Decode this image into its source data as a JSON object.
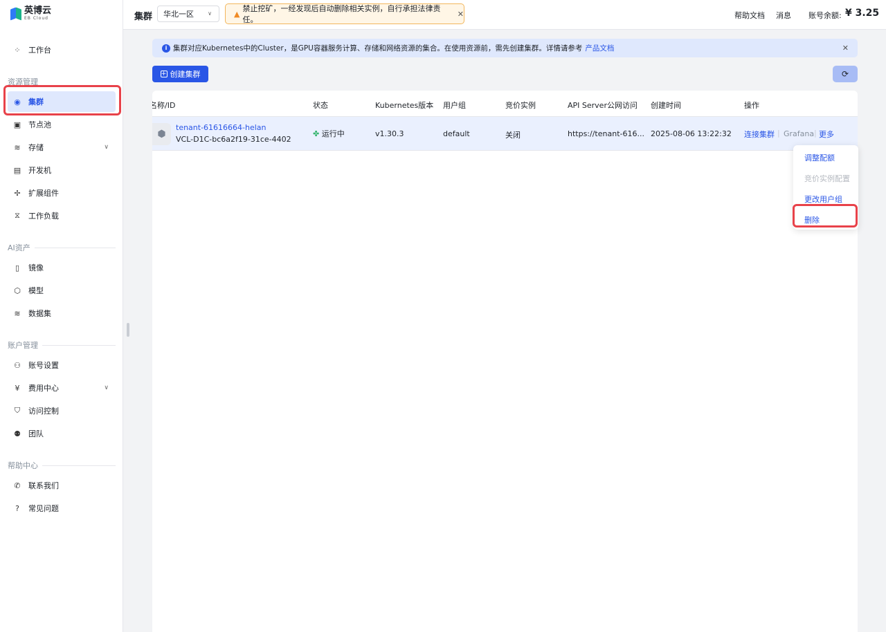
{
  "brand": {
    "name_cn": "英博云",
    "name_en": "EB Cloud"
  },
  "sidebar": {
    "items": [
      {
        "label": "工作台",
        "icon": "grid-icon"
      },
      {
        "label": "集群",
        "icon": "cluster-icon"
      },
      {
        "label": "节点池",
        "icon": "node-pool-icon"
      },
      {
        "label": "存储",
        "icon": "database-icon"
      },
      {
        "label": "开发机",
        "icon": "dev-machine-icon"
      },
      {
        "label": "扩展组件",
        "icon": "puzzle-icon"
      },
      {
        "label": "工作负载",
        "icon": "hourglass-icon"
      },
      {
        "label": "镜像",
        "icon": "mirror-icon"
      },
      {
        "label": "模型",
        "icon": "cube-icon"
      },
      {
        "label": "数据集",
        "icon": "dataset-icon"
      },
      {
        "label": "账号设置",
        "icon": "user-icon"
      },
      {
        "label": "费用中心",
        "icon": "billing-icon"
      },
      {
        "label": "访问控制",
        "icon": "shield-icon"
      },
      {
        "label": "团队",
        "icon": "team-icon"
      },
      {
        "label": "联系我们",
        "icon": "phone-icon"
      },
      {
        "label": "常见问题",
        "icon": "question-icon"
      }
    ],
    "sections": {
      "resource": "资源管理",
      "ai": "AI资产",
      "account": "账户管理",
      "help": "帮助中心"
    }
  },
  "header": {
    "title": "集群",
    "region": "华北一区",
    "warning": "禁止挖矿，一经发现后自动删除相关实例，自行承担法律责任。",
    "help_docs": "帮助文档",
    "messages": "消息",
    "balance_label": "账号余额:",
    "balance_value": "¥ 3.25"
  },
  "info_bar": {
    "text": "集群对应Kubernetes中的Cluster，是GPU容器服务计算、存储和网络资源的集合。在使用资源前，需先创建集群。详情请参考",
    "link": "产品文档"
  },
  "toolbar": {
    "create_label": "创建集群"
  },
  "table": {
    "columns": [
      "名称/ID",
      "状态",
      "Kubernetes版本",
      "用户组",
      "竞价实例",
      "API Server公网访问",
      "创建时间",
      "操作"
    ],
    "rows": [
      {
        "name": "tenant-61616664-helan",
        "id": "VCL-D1C-bc6a2f19-31ce-4402",
        "status": "运行中",
        "k8s_version": "v1.30.3",
        "user_group": "default",
        "spot": "关闭",
        "api_server": "https://tenant-616...",
        "created": "2025-08-06 13:22:32",
        "actions": {
          "connect": "连接集群",
          "grafana": "Grafana",
          "more": "更多"
        }
      }
    ]
  },
  "more_menu": {
    "items": [
      {
        "label": "调整配额",
        "state": "enabled"
      },
      {
        "label": "竞价实例配置",
        "state": "disabled"
      },
      {
        "label": "更改用户组",
        "state": "enabled"
      },
      {
        "label": "删除",
        "state": "enabled"
      }
    ]
  }
}
